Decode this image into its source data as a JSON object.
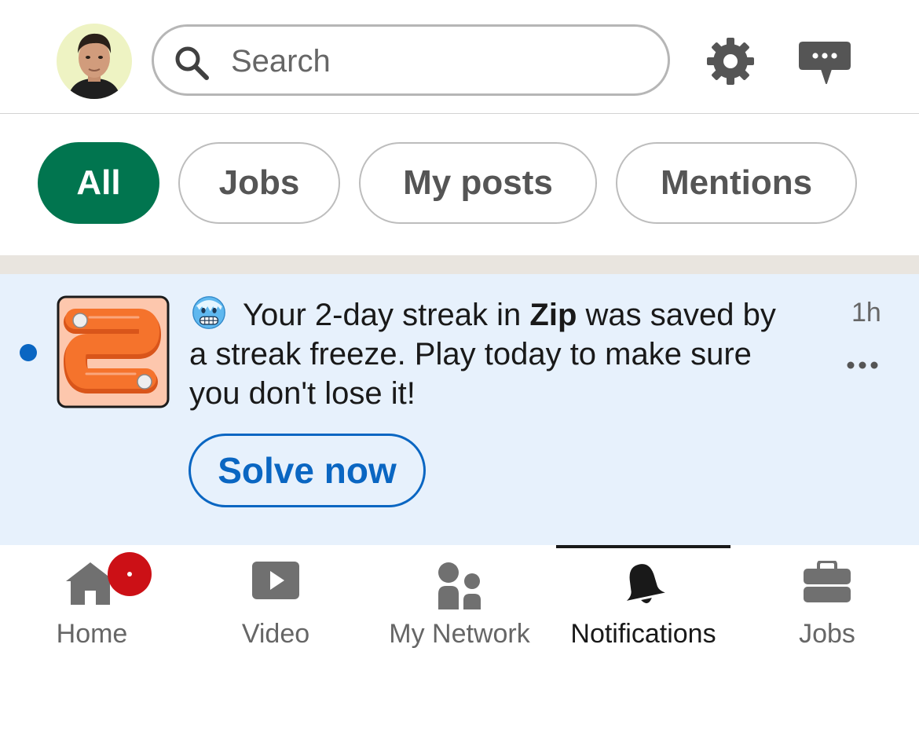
{
  "header": {
    "search": {
      "placeholder": "Search",
      "value": ""
    }
  },
  "filters": [
    {
      "label": "All",
      "active": true
    },
    {
      "label": "Jobs",
      "active": false
    },
    {
      "label": "My posts",
      "active": false
    },
    {
      "label": "Mentions",
      "active": false
    }
  ],
  "notification": {
    "unread": true,
    "text_before": "Your 2-day streak in ",
    "app_name": "Zip",
    "text_after": " was saved by a streak freeze. Play today to make sure you don't lose it!",
    "time": "1h",
    "action_label": "Solve now",
    "emoji": "freezing-face-icon",
    "accent_color": "#0a66c2"
  },
  "bottom_nav": [
    {
      "label": "Home",
      "icon": "home-icon",
      "badge": true
    },
    {
      "label": "Video",
      "icon": "video-icon"
    },
    {
      "label": "My Network",
      "icon": "my-network-icon"
    },
    {
      "label": "Notifications",
      "icon": "bell-icon",
      "active": true
    },
    {
      "label": "Jobs",
      "icon": "briefcase-icon"
    }
  ],
  "colors": {
    "filter_active": "#01754f",
    "notification_bg": "#e7f1fc",
    "badge": "#cc1016"
  }
}
